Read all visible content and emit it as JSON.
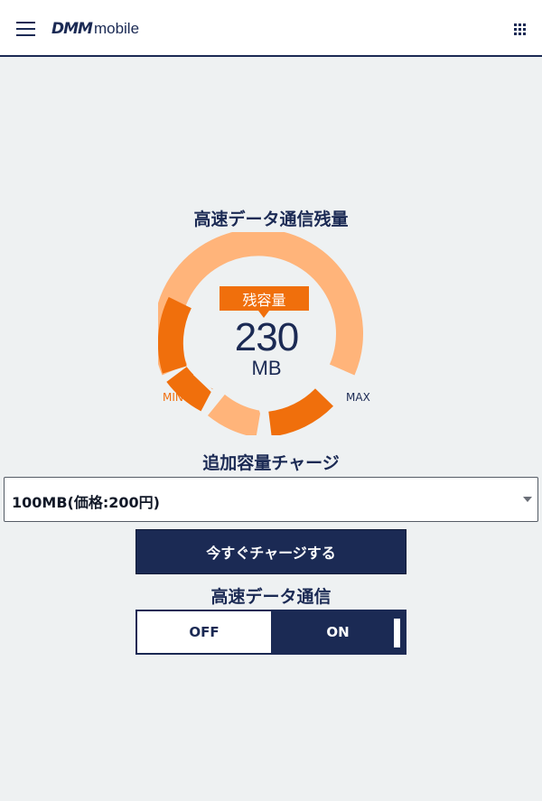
{
  "header": {
    "logo_brand": "DMM",
    "logo_product": "mobile",
    "icons": [
      "hamburger-menu-icon",
      "apps-grid-icon"
    ]
  },
  "gauge": {
    "title": "高速データ通信残量",
    "badge_label": "残容量",
    "value": "230",
    "unit": "MB",
    "min_label": "MIN",
    "max_label": "MAX",
    "remaining_fraction": 0.45,
    "colors": {
      "track": "#ffb47a",
      "fill": "#f06f0c",
      "text": "#1b2a54"
    }
  },
  "charge": {
    "title": "追加容量チャージ",
    "selected_option": "100MB(価格:200円)",
    "button_label": "今すぐチャージする"
  },
  "high_speed": {
    "title": "高速データ通信",
    "off_label": "OFF",
    "on_label": "ON",
    "state": "ON"
  },
  "colors": {
    "navy": "#1b2a54",
    "orange": "#f06f0c",
    "background": "#eef1f2"
  }
}
